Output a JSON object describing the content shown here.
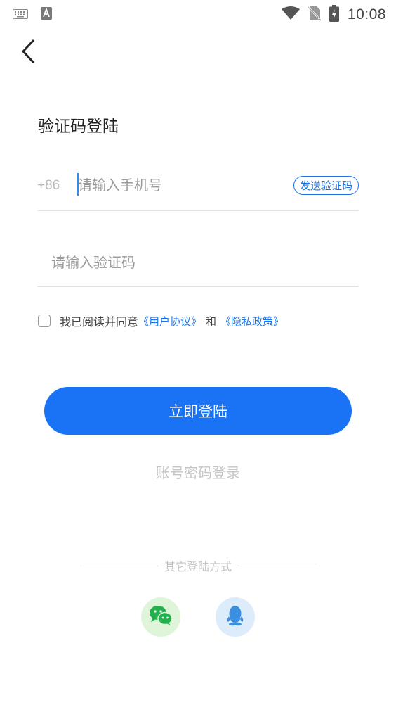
{
  "status_bar": {
    "time": "10:08"
  },
  "header": {
    "title": "验证码登陆"
  },
  "phone": {
    "country_code": "+86",
    "placeholder": "请输入手机号",
    "send_code_label": "发送验证码"
  },
  "code": {
    "placeholder": "请输入验证码"
  },
  "agreement": {
    "prefix": "我已阅读并同意",
    "user_agreement": "《用户协议》",
    "and": "和",
    "privacy_policy": "《隐私政策》"
  },
  "actions": {
    "login_label": "立即登陆",
    "password_login_label": "账号密码登录"
  },
  "other_login": {
    "label": "其它登陆方式",
    "methods": [
      {
        "icon": "wechat-icon",
        "color": "#22b14c"
      },
      {
        "icon": "qq-icon",
        "color": "#3b8fe0"
      }
    ]
  },
  "colors": {
    "accent": "#1a73f5",
    "link": "#1a73e8"
  }
}
